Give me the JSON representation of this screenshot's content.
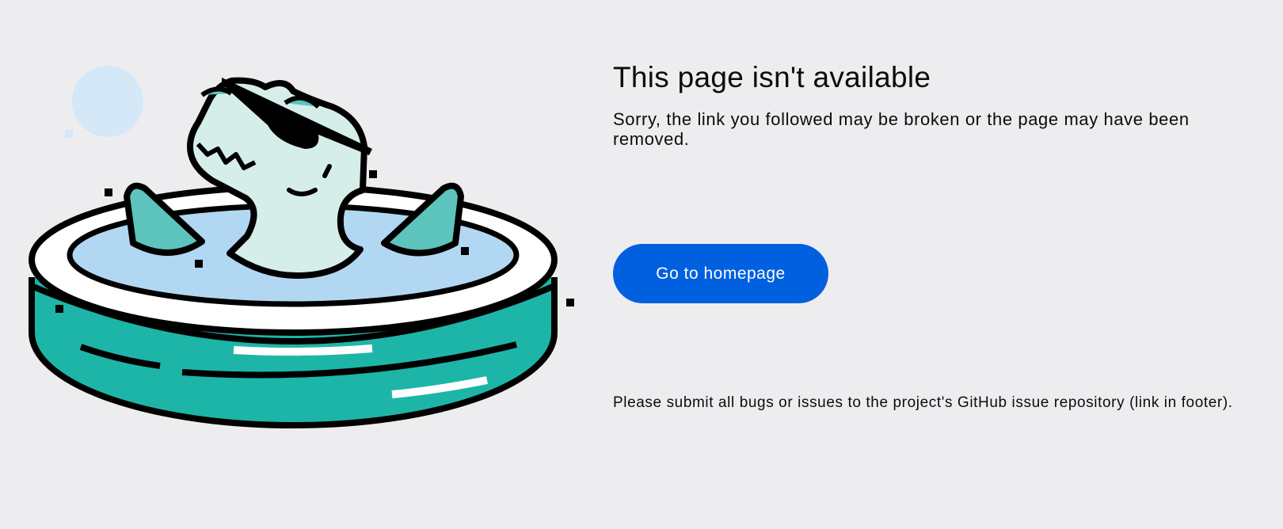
{
  "page": {
    "title": "This page isn't available",
    "subtitle": "Sorry, the link you followed may be broken or the page may have been removed.",
    "button_label": "Go to homepage",
    "footer_note": "Please submit all bugs or issues to the project's GitHub issue repository (link in footer)."
  },
  "illustration": {
    "icon": "dinosaur-in-pool-illustration"
  },
  "colors": {
    "background": "#ededf0",
    "button": "#0060df",
    "pool": "#1db5a8",
    "water": "#b5d8f2",
    "dino": "#d8eeea"
  }
}
